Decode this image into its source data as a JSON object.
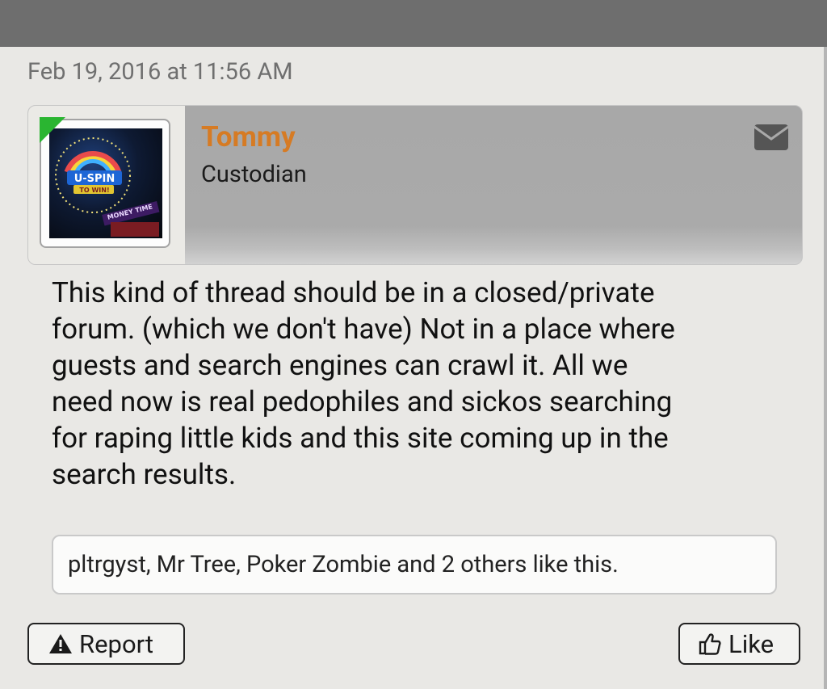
{
  "post": {
    "timestamp": "Feb 19, 2016 at 11:56 AM",
    "author": {
      "name": "Tommy",
      "title": "Custodian",
      "avatar_text_top": "U-SPIN",
      "avatar_text_sub": "TO WIN!",
      "avatar_text_bottom": "MONEY TIME"
    },
    "message": {
      "lines": [
        "This kind of thread should be in a closed/private",
        "forum. (which we don't have) Not in a place where",
        "guests and search engines can crawl it. All we",
        "need now is real pedophiles and sickos searching",
        "for raping little kids and this site coming up in the",
        "search results."
      ]
    },
    "likes_summary": "pltrgyst, Mr Tree, Poker Zombie and 2 others like this.",
    "actions": {
      "report_label": "Report",
      "like_label": "Like"
    }
  },
  "colors": {
    "username": "#d67b24",
    "online": "#2ab531",
    "annotation": "#e8302a",
    "topbar": "#6e6e6e"
  },
  "icons": [
    "mail-icon",
    "warning-icon",
    "thumbs-up-icon"
  ]
}
